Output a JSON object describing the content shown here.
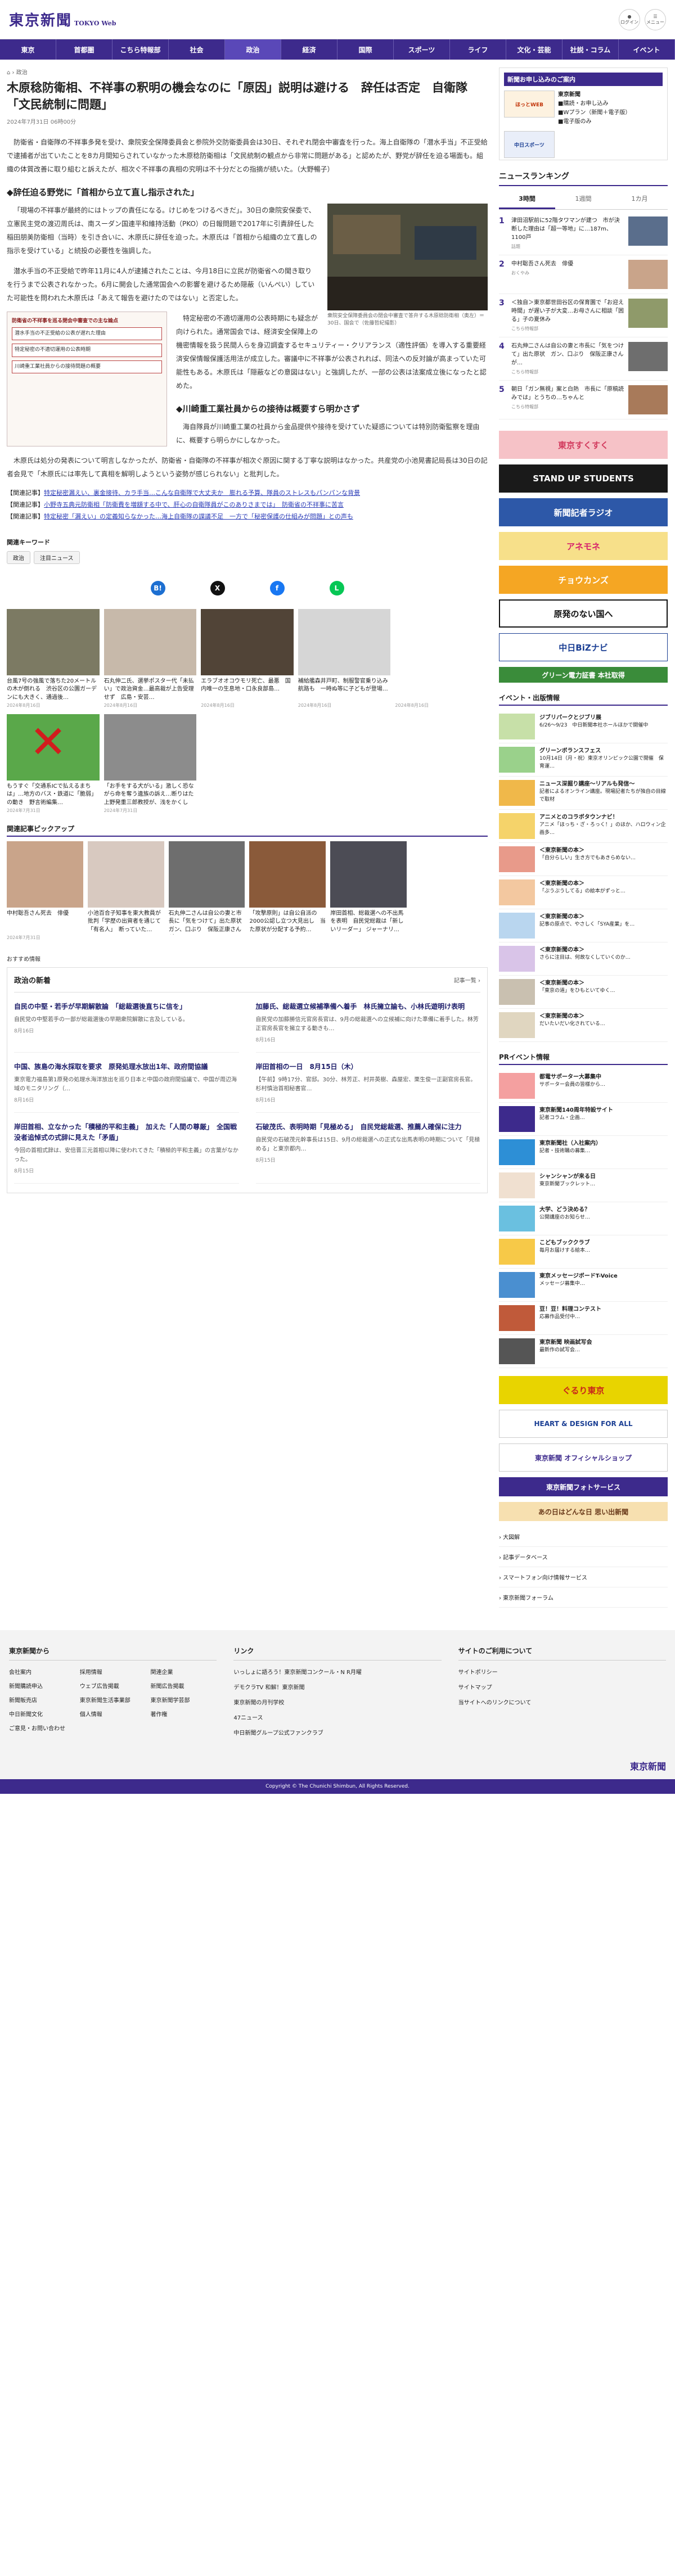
{
  "header": {
    "logo": "東京新聞",
    "logo_sub": "TOKYO Web",
    "icon_user": "ログイン",
    "icon_menu": "メニュー"
  },
  "nav": [
    "東京",
    "首都圏",
    "こちら特報部",
    "社会",
    "政治",
    "経済",
    "国際",
    "スポーツ",
    "ライフ",
    "文化・芸能",
    "社説・コラム",
    "イベント"
  ],
  "article": {
    "crumb": "政治",
    "title": "木原稔防衛相、不祥事の釈明の機会なのに「原因」説明は避ける　辞任は否定　自衛隊「文民統制に問題」",
    "date": "2024年7月31日 06時00分",
    "p1": "防衛省・自衛隊の不祥事多発を受け、衆院安全保障委員会と参院外交防衛委員会は30日、それぞれ閉会中審査を行った。海上自衛隊の「潜水手当」不正受給で逮捕者が出ていたことを8カ月間知らされていなかった木原稔防衛相は「文民統制の観点から非常に問題がある」と認めたが、野党が辞任を迫る場面も。組織の体質改善に取り組むと訴えたが、相次ぐ不祥事の真相の究明は不十分だとの指摘が続いた。（大野暢子）",
    "h1": "◆辞任迫る野党に「首相から立て直し指示された」",
    "p2": "「現場の不祥事が最終的にはトップの責任になる。けじめをつけるべきだ」。30日の衆院安保委で、立憲民主党の渡辺周氏は、南スーダン国連平和維持活動（PKO）の日報問題で2017年に引責辞任した稲田朋美防衛相（当時）を引き合いに、木原氏に辞任を迫った。木原氏は「首相から組織の立て直しの指示を受けている」と続投の必要性を強調した。",
    "p3": "潜水手当の不正受給で昨年11月に4人が逮捕されたことは、今月18日に立民が防衛省への聞き取りを行うまで公表されなかった。6月に開会した通常国会への影響を避けるため隠蔽（いんぺい）していた可能性を問われた木原氏は「あえて報告を避けたのではない」と否定した。",
    "p4": "特定秘密の不適切運用の公表時期にも疑念が向けられた。通常国会では、経済安全保障上の機密情報を扱う民間人らを身辺調査するセキュリティー・クリアランス（適性評価）を導入する重要経済安保情報保護活用法が成立した。審議中に不祥事が公表されれば、同法への反対論が高まっていた可能性もある。木原氏は「隠蔽などの意図はない」と強調したが、一部の公表は法案成立後になったと認めた。",
    "h2": "◆川崎重工業社員からの接待は概要すら明かさず",
    "p5": "海自隊員が川崎重工業の社員から金品提供や接待を受けていた疑惑については特別防衛監察を理由に、概要すら明らかにしなかった。",
    "p6": "木原氏は処分の発表について明言しなかったが、防衛省・自衛隊の不祥事が相次ぐ原因に関する丁寧な説明はなかった。共産党の小池晃書記局長は30日の記者会見で「木原氏には率先して真相を解明しようという姿勢が感じられない」と批判した。",
    "photo_caption": "衆院安全保障委員会の閉会中審査で答弁する木原稔防衛相（奥左）＝30日、国会で（佐藤哲紀撮影）",
    "diagram_title": "防衛省の不祥事を巡る閉会中審査での主な論点",
    "diagram_items": [
      "潜水手当の不正受給の公表が遅れた理由",
      "特定秘密の不適切運用の公表時期",
      "川崎重工業社員からの接待問題の概要"
    ],
    "related": [
      {
        "tag": "【関連記事】",
        "text": "特定秘密漏えい、裏金接待、カラ手当…こんな自衛隊で大丈夫か　膨れる予算、隊員のストレスもパンパンな背景"
      },
      {
        "tag": "【関連記事】",
        "text": "小野寺五典元防衛相「防衛費を増額する中で、肝心の自衛隊員がこのありさまでは」　防衛省の不祥事に苦言"
      },
      {
        "tag": "【関連記事】",
        "text": "特定秘密「漏えい」の定義知らなかった…海上自衛隊の諜議不足　一方で「秘密保護の仕組みが問題」との声も"
      }
    ],
    "kw_title": "関連キーワード",
    "keywords": [
      "政治",
      "注目ニュース"
    ]
  },
  "share": {
    "b": "B!",
    "x": "X",
    "f": "f",
    "l": "L"
  },
  "cards": [
    {
      "t": "台風7号の強風で落ちた20メートルの木が倒れる　渋谷区の公園ガーデンにも大きく、通過後…",
      "d": "2024年8月16日"
    },
    {
      "t": "石丸伸二氏、選挙ポスター代「未払い」で政治資金…最高裁が上告受理せず　広島・安芸…",
      "d": "2024年8月16日"
    },
    {
      "t": "エラブオオコウモリ死亡、最悪　国内唯一の生息地・口永良部島…",
      "d": "2024年8月16日"
    },
    {
      "t": "補給艦森井戸町、制服警官乗り込み航路も　一時ぬ等に子どもが登場…",
      "d": "2024年8月16日"
    },
    {
      "t": "",
      "d": "2024年8月16日"
    },
    {
      "t": "もうすぐ「交通系ICで払えるまちは」…地方のバス・鉄道に「脆弱」の動き　野言術編集…",
      "d": "2024年7月31日"
    },
    {
      "t": "「お手をする犬がいる」激しく恐ながら命を奪う遺族の訴え…断りはた上野発重三郎教授が、浅をかくして…",
      "d": "2024年7月31日"
    }
  ],
  "pick_title": "関連記事ピックアップ",
  "picks": [
    {
      "t": "中村聡吾さん死去　俳優",
      "d": "2024年7月31日"
    },
    {
      "t": "小池百合子知事を東大教員が批判「学歴の出資者を通じて「有名人」　断っていた…",
      "d": ""
    },
    {
      "t": "石丸伸二さんは自公の妻と市長に「気をつけて」出た原状　ガン、口ぶり　保阪正康さんが…",
      "d": ""
    },
    {
      "t": "「攻撃原則」は自公自派の2000公認し立つ大見出し　当た原状が分配する予約…",
      "d": ""
    },
    {
      "t": "岸田首相、総裁選への不出馬を表明　自民党総裁は「新しいリーダー」 ジャーナリ…",
      "d": ""
    }
  ],
  "osusume": "おすすめ情報",
  "news_title": "政治の新着",
  "news_more": "記事一覧 ›",
  "news": [
    {
      "t": "自民の中堅・若手が早期解散論　「総裁選後直ちに信を」",
      "b": "自民党の中堅若手の一部が総裁選後の早期衆院解散に言及している。",
      "d": "8月16日"
    },
    {
      "t": "加藤氏、総裁選立候補準備へ着手　林氏擁立論も、小林氏遊明け表明",
      "b": "自民党の加藤勝信元官房長官は、9月の総裁選への立候補に向けた準備に着手した。林芳正官房長官を擁立する動きも…",
      "d": "8月16日"
    },
    {
      "t": "中国、族島の海水採取を要求　原発処理水放出1年、政府間協議",
      "b": "東京電力福島第1原発の処理水海洋放出を巡り日本と中国の政府間協議で、中国が周辺海域のモニタリング（…",
      "d": "8月16日"
    },
    {
      "t": "岸田首相の一日　8月15日（木）",
      "b": "【午前】9時17分、官邸。30分、林芳正、村井英樹、森屋宏、栗生俊一正副官房長官。杉村慎治首相秘書官…",
      "d": "8月16日"
    },
    {
      "t": "岸田首相、立なかった「積極的平和主義」　加えた「人間の尊厳」　全国戦没者追悼式の式辞に見えた「矛盾」",
      "b": "今回の首相式辞は、安倍晋三元首相以降に使われてきた「積極的平和主義」の言葉がなかった。",
      "d": "8月15日"
    },
    {
      "t": "石破茂氏、表明時期「見極める」　自民党総裁選、推薦人確保に注力",
      "b": "自民党の石破茂元幹事長は15日、9月の総裁選への正式な出馬表明の時期について「見極める」と東京都内…",
      "d": "8月15日"
    }
  ],
  "side": {
    "sub_head": "新聞お申し込みのご案内",
    "sub_paper": "東京新聞",
    "sub_items": [
      "■購読・お申し込み",
      "■Wプラン（新聞＋電子版）",
      "■電子版のみ"
    ],
    "mini1": "ほっとWEB",
    "mini2": "中日スポーツ",
    "rank_head": "ニュースランキング",
    "rank_tabs": [
      "3時間",
      "1週間",
      "1カ月"
    ],
    "rank": [
      {
        "t": "津田沼駅前に52階タワマンが建つ　市が決断した理由は「超一等地」に…187m、1100戸",
        "s": "話題"
      },
      {
        "t": "中村聡吾さん死去　俳優",
        "s": "おくやみ"
      },
      {
        "t": "＜独自＞東京都世田谷区の保育園で「お迎え時間」が遅い子が大変…お母さんに相談「困る」子の夏休み",
        "s": "こちら特報部"
      },
      {
        "t": "石丸伸二さんは自公の妻と市長に「気をつけて」出た原状　ガン、口ぶり　保阪正康さんが…",
        "s": "こちら特報部"
      },
      {
        "t": "朝日「ガン無視」案と白熱　市長に「原稿読みでは」とうちの…ちゃんと",
        "s": "こちら特報部"
      }
    ],
    "banners": [
      {
        "t": "東京すくすく",
        "bg": "#f6c2c7",
        "fg": "#d23b5e"
      },
      {
        "t": "STAND UP STUDENTS",
        "bg": "#1a1a1a",
        "fg": "#fff"
      },
      {
        "t": "新聞記者ラジオ",
        "bg": "#2d58a8",
        "fg": "#fff"
      },
      {
        "t": "アネモネ",
        "bg": "#f7e08a",
        "fg": "#d61f6b"
      },
      {
        "t": "チョウカンズ",
        "bg": "#f5a623",
        "fg": "#fff"
      },
      {
        "t": "原発のない国へ",
        "bg": "#fff",
        "fg": "#111"
      },
      {
        "t": "中日BiZナビ",
        "bg": "#fff",
        "fg": "#1b3f94"
      },
      {
        "t": "グリーン電力証書 本社取得",
        "bg": "#3a8c3a",
        "fg": "#fff"
      }
    ],
    "ev_head": "イベント・出版情報",
    "events": [
      {
        "b": "ジブリパークとジブリ展",
        "t": "6/26〜9/23　中日新聞本社ホールほかで開催中"
      },
      {
        "b": "グリーンボランスフェス",
        "t": "10月14日（月・祝）東京オリンピック公園で開催　保育運…"
      },
      {
        "b": "ニュース深掘り講座〜リアルも発信〜",
        "t": "記者によるオンライン講座。現場記者たちが独自の目線で取材"
      },
      {
        "b": "アニメとのコラボタウンナビ！",
        "t": "アニメ「ほっち・ざ・ろっく！」のほか、ハロウィン企画多…"
      },
      {
        "b": "＜東京新聞の本＞",
        "t": "「自分らしい」生き方でもあきらめない…"
      },
      {
        "b": "＜東京新聞の本＞",
        "t": "「ぷうぷうしてる」の絵本がずっと…"
      },
      {
        "b": "＜東京新聞の本＞",
        "t": "記事の原点で、やさしく「SYA産業」を…"
      },
      {
        "b": "＜東京新聞の本＞",
        "t": "さらに注目は、何故なくしていくのか…"
      },
      {
        "b": "＜東京新聞の本＞",
        "t": "「東京の道」をひもといてゆく…"
      },
      {
        "b": "＜東京新聞の本＞",
        "t": "だいたいだい化されている…"
      }
    ],
    "pr_head": "PRイベント情報",
    "prs": [
      {
        "b": "都電サポーター大募集中",
        "t": "サポーター会員の皆様から…"
      },
      {
        "b": "東京新聞140周年特設サイト",
        "t": "記者コラム・企画…"
      },
      {
        "b": "東京新聞社（入社案内）",
        "t": "記者・技術職の募集…"
      },
      {
        "b": "シャンシャンが来る日",
        "t": "東京新聞ブックレット…"
      },
      {
        "b": "大学、どう決める？",
        "t": "公開講座のお知らせ…"
      },
      {
        "b": "こどもブッククラブ",
        "t": "毎月お届けする絵本…"
      },
      {
        "b": "東京メッセージボードT-Voice",
        "t": "メッセージ募集中…"
      },
      {
        "b": "豆！豆！料理コンテスト",
        "t": "応募作品受付中…"
      },
      {
        "b": "東京新聞 映画試写会",
        "t": "最新作の試写会…"
      }
    ],
    "bottom_banners": [
      {
        "t": "ぐるり東京",
        "bg": "#e8d400",
        "fg": "#c8261a"
      },
      {
        "t": "HEART & DESIGN FOR ALL",
        "bg": "#fff",
        "fg": "#1b3f94"
      },
      {
        "t": "東京新聞 オフィシャルショップ",
        "bg": "#fff",
        "fg": "#3d2a8c"
      },
      {
        "t": "東京新聞フォトサービス",
        "bg": "#3d2a8c",
        "fg": "#fff"
      },
      {
        "t": "あの日はどんな日 思い出新聞",
        "bg": "#f7e0b0",
        "fg": "#6a3a1a"
      }
    ],
    "links": [
      "› 大図解",
      "› 記事データベース",
      "› スマートフォン向け情報サービス",
      "› 東京新聞フォーラム"
    ]
  },
  "footer": {
    "c1_h": "東京新聞から",
    "c1": [
      "会社案内",
      "採用情報",
      "関連企業",
      "新聞購読申込",
      "ウェブ広告掲載",
      "新聞広告掲載",
      "新聞販売店",
      "東京新聞生活事業部",
      "東京新聞学芸部",
      "中日新聞文化",
      "個人情報",
      "著作権",
      "ご意見・お問い合わせ"
    ],
    "c2_h": "リンク",
    "c2": [
      "いっしょに語ろう！東京新聞コンクール・N R月曜",
      "デモクラTV 和解！東京新聞",
      "東京新聞の月刊学校",
      "47ニュース",
      "中日新聞グループ公式ファンクラブ"
    ],
    "c3_h": "サイトのご利用について",
    "c3": [
      "サイトポリシー",
      "サイトマップ",
      "当サイトへのリンクについて"
    ],
    "logo": "東京新聞",
    "copy": "Copyright © The Chunichi Shimbun, All Rights Reserved."
  }
}
